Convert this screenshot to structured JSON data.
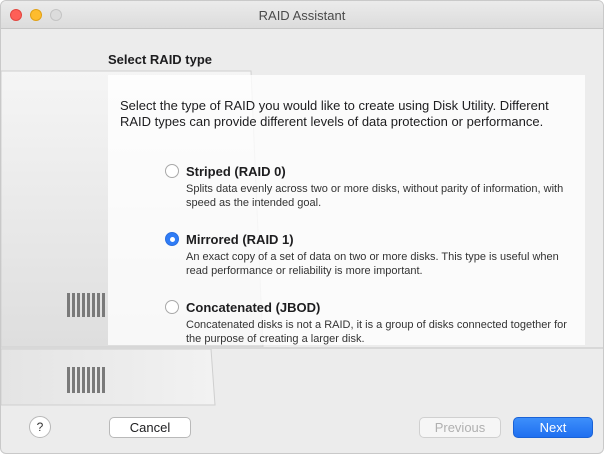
{
  "window": {
    "title": "RAID Assistant"
  },
  "page": {
    "section_title": "Select RAID type",
    "intro": "Select the type of RAID you would like to create using Disk Utility. Different RAID types can provide different levels of data protection or performance."
  },
  "options": [
    {
      "label": "Striped (RAID 0)",
      "description": "Splits data evenly across two or more disks, without parity of information, with speed as the intended goal.",
      "selected": false
    },
    {
      "label": "Mirrored (RAID 1)",
      "description": "An exact copy of a set of data on two or more disks. This type is useful when read performance or reliability is more important.",
      "selected": true
    },
    {
      "label": "Concatenated (JBOD)",
      "description": "Concatenated disks is not a RAID, it is a group of disks connected together for the purpose of creating a larger disk.",
      "selected": false
    }
  ],
  "buttons": {
    "help": "?",
    "cancel": "Cancel",
    "previous": "Previous",
    "next": "Next"
  },
  "colors": {
    "accent": "#2f7cf6",
    "close": "#fe5f57",
    "minimize": "#febc2e"
  }
}
